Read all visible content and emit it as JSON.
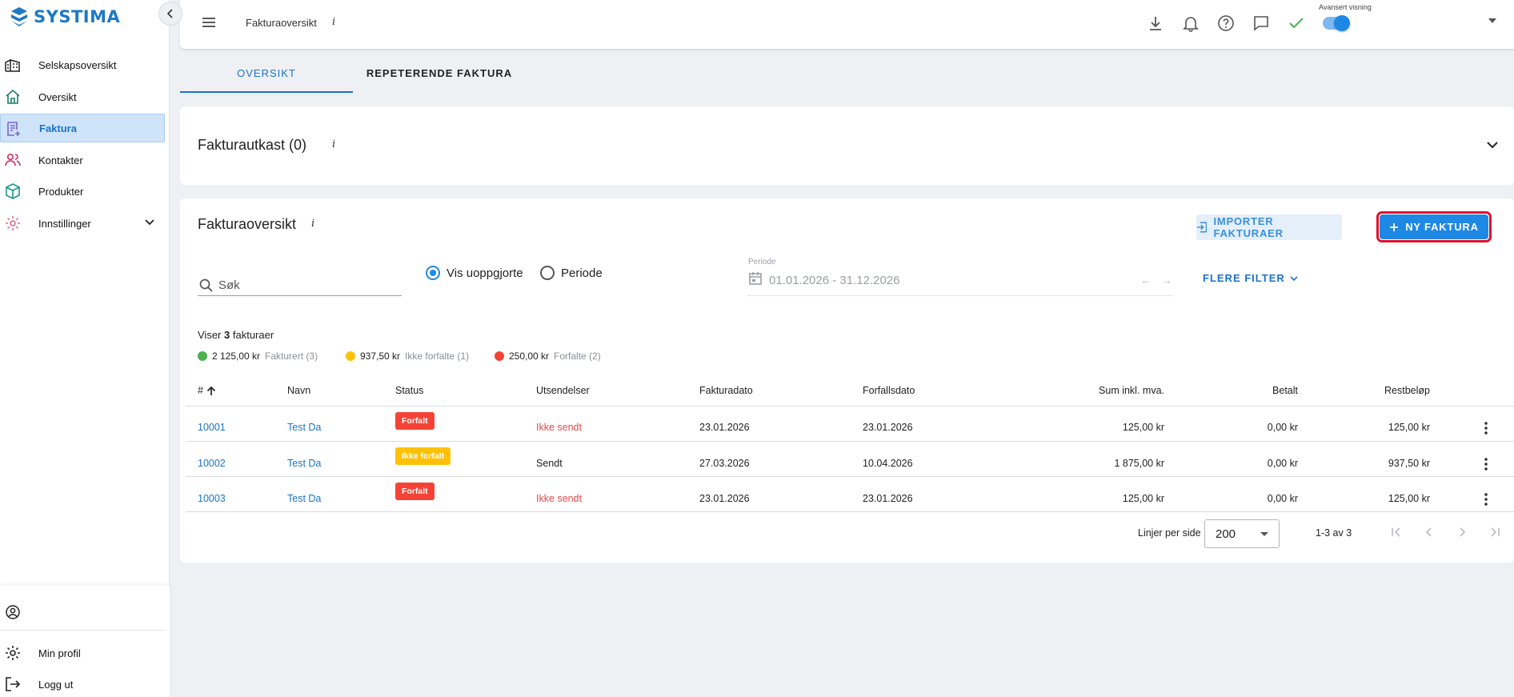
{
  "app": {
    "logo_text": "SYSTIMA",
    "brand_color": "#1d79c4",
    "accent": "#1e88e5"
  },
  "sidebar": {
    "items": [
      {
        "label": "Selskapsoversikt",
        "icon": "company-building-icon"
      },
      {
        "label": "Oversikt",
        "icon": "home-icon"
      },
      {
        "label": "Faktura",
        "icon": "invoice-icon",
        "active": true
      },
      {
        "label": "Kontakter",
        "icon": "contacts-icon"
      },
      {
        "label": "Produkter",
        "icon": "box-icon"
      },
      {
        "label": "Innstillinger",
        "icon": "gear-icon"
      }
    ],
    "bottom": [
      {
        "label": "Min profil",
        "icon": "gear-icon"
      },
      {
        "label": "Logg ut",
        "icon": "logout-icon"
      }
    ]
  },
  "topbar": {
    "title": "Fakturaoversikt",
    "info": "i",
    "advanced_label": "Avansert visning",
    "advanced_on": true
  },
  "tabs": [
    {
      "label": "OVERSIKT",
      "active": true
    },
    {
      "label": "REPETERENDE FAKTURA",
      "active": false
    }
  ],
  "drafts": {
    "title": "Fakturautkast (0)",
    "info": "i"
  },
  "overview": {
    "title": "Fakturaoversikt",
    "info": "i",
    "import_label": "IMPORTER FAKTURAER",
    "new_label": "NY FAKTURA",
    "search_placeholder": "Søk",
    "radio_unsettled": "Vis uoppgjorte",
    "radio_period": "Periode",
    "period_label": "Periode",
    "period_value": "01.01.2026 - 31.12.2026",
    "more_filters": "FLERE FILTER",
    "count_prefix": "Viser",
    "count_value": "3",
    "count_suffix": "fakturaer",
    "summary": [
      {
        "amount": "2 125,00 kr",
        "label": "Fakturert (3)",
        "color": "#4caf50"
      },
      {
        "amount": "937,50 kr",
        "label": "Ikke forfalte (1)",
        "color": "#ffc107"
      },
      {
        "amount": "250,00 kr",
        "label": "Forfalte (2)",
        "color": "#f44336"
      }
    ]
  },
  "table": {
    "headers": [
      "#",
      "Navn",
      "Status",
      "Utsendelser",
      "Fakturadato",
      "Forfallsdato",
      "Sum inkl. mva.",
      "Betalt",
      "Restbeløp"
    ],
    "rows": [
      {
        "nr": "10001",
        "name": "Test Da",
        "status": "Forfalt",
        "status_color": "#f44336",
        "sent": "Ikke sendt",
        "sent_red": true,
        "inv_date": "23.01.2026",
        "due_date": "23.01.2026",
        "sum": "125,00 kr",
        "paid": "0,00 kr",
        "rest": "125,00 kr"
      },
      {
        "nr": "10002",
        "name": "Test Da",
        "status": "Ikke forfalt",
        "status_color": "#ffc107",
        "sent": "Sendt",
        "sent_red": false,
        "inv_date": "27.03.2026",
        "due_date": "10.04.2026",
        "sum": "1 875,00 kr",
        "paid": "0,00 kr",
        "rest": "937,50 kr"
      },
      {
        "nr": "10003",
        "name": "Test Da",
        "status": "Forfalt",
        "status_color": "#f44336",
        "sent": "Ikke sendt",
        "sent_red": true,
        "inv_date": "23.01.2026",
        "due_date": "23.01.2026",
        "sum": "125,00 kr",
        "paid": "0,00 kr",
        "rest": "125,00 kr"
      }
    ]
  },
  "pagination": {
    "rows_label": "Linjer per side",
    "rows_value": "200",
    "range": "1-3 av 3"
  }
}
